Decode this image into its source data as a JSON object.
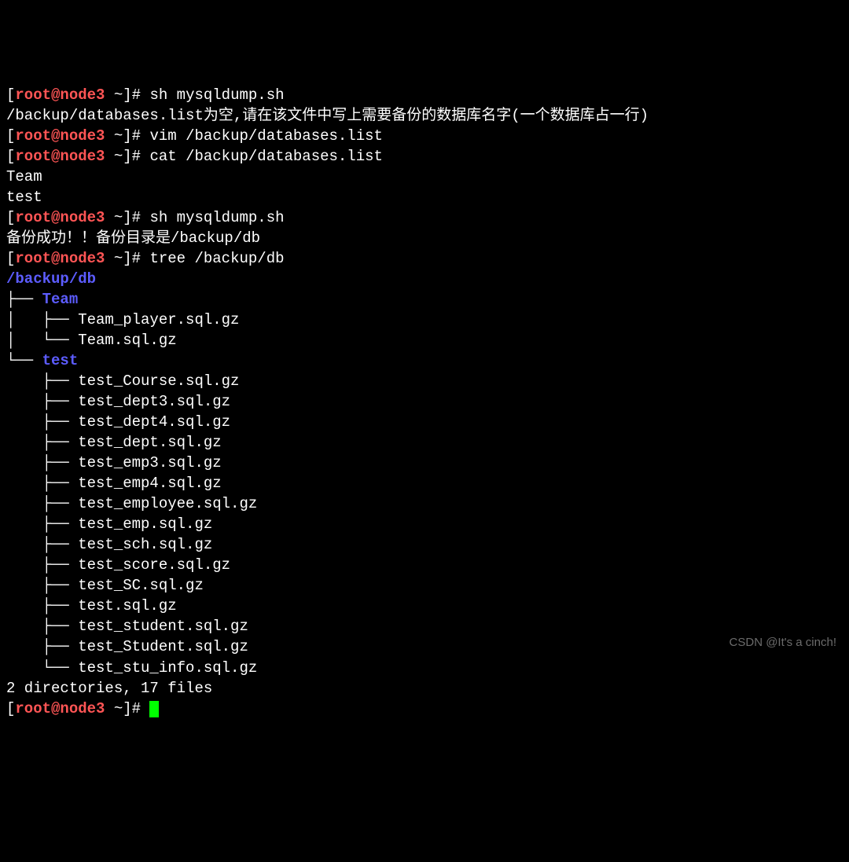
{
  "prompt_open": "[",
  "prompt_user": "root@node3",
  "prompt_path": " ~",
  "prompt_close": "]# ",
  "lines": {
    "l1_cmd": "sh mysqldump.sh",
    "l2": "/backup/databases.list为空,请在该文件中写上需要备份的数据库名字(一个数据库占一行)",
    "l3_cmd": "vim /backup/databases.list",
    "l4_cmd": "cat /backup/databases.list",
    "l5": "Team",
    "l6": "test",
    "l7_cmd": "sh mysqldump.sh",
    "l8": "备份成功！！备份目录是/backup/db",
    "l9_cmd": "tree /backup/db",
    "l10": "/backup/db",
    "l11": "├── ",
    "l11b": "Team",
    "l12": "│   ├── Team_player.sql.gz",
    "l13": "│   └── Team.sql.gz",
    "l14": "└── ",
    "l14b": "test",
    "l15": "    ├── test_Course.sql.gz",
    "l16": "    ├── test_dept3.sql.gz",
    "l17": "    ├── test_dept4.sql.gz",
    "l18": "    ├── test_dept.sql.gz",
    "l19": "    ├── test_emp3.sql.gz",
    "l20": "    ├── test_emp4.sql.gz",
    "l21": "    ├── test_employee.sql.gz",
    "l22": "    ├── test_emp.sql.gz",
    "l23": "    ├── test_sch.sql.gz",
    "l24": "    ├── test_score.sql.gz",
    "l25": "    ├── test_SC.sql.gz",
    "l26": "    ├── test.sql.gz",
    "l27": "    ├── test_student.sql.gz",
    "l28": "    ├── test_Student.sql.gz",
    "l29": "    └── test_stu_info.sql.gz",
    "l30": "",
    "l31": "2 directories, 17 files"
  },
  "watermark": "CSDN @It's a cinch!"
}
